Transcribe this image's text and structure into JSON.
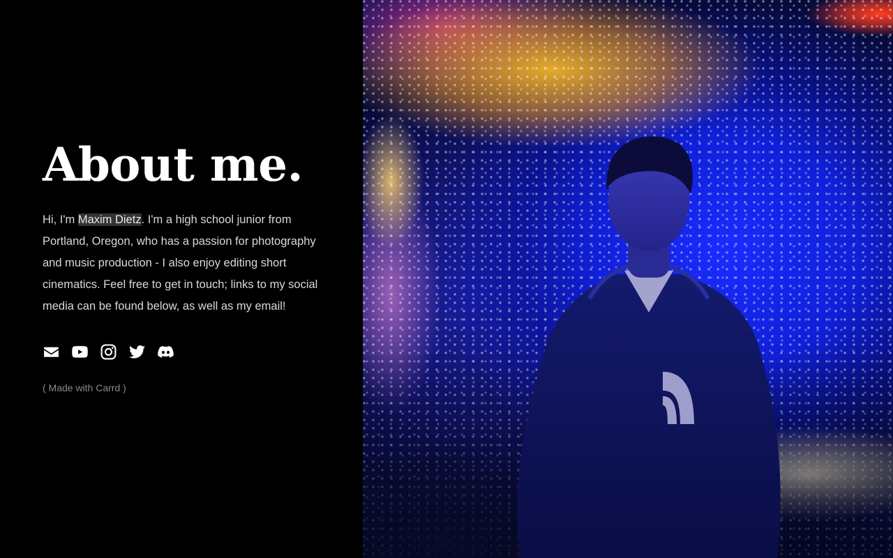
{
  "about": {
    "title": "About me.",
    "bio_intro": "Hi, I'm ",
    "name": "Maxim Dietz",
    "bio_rest": ". I'm a high school junior from Portland, Oregon, who has a passion for photography and music production - I also enjoy editing short cinematics. Feel free to get in touch; links to my social media can be found below, as well as my email!"
  },
  "social_links": [
    {
      "icon": "envelope-icon",
      "label": "Email"
    },
    {
      "icon": "youtube-icon",
      "label": "YouTube"
    },
    {
      "icon": "instagram-icon",
      "label": "Instagram"
    },
    {
      "icon": "twitter-icon",
      "label": "Twitter"
    },
    {
      "icon": "discord-icon",
      "label": "Discord"
    }
  ],
  "credit": "( Made with Carrd )",
  "colors": {
    "background": "#000000",
    "heading": "#ffffff",
    "body_text": "#d9d9d9",
    "name_highlight": "#333333",
    "credit": "#8a8a8a"
  },
  "photo": {
    "subject": "portrait-photo"
  }
}
